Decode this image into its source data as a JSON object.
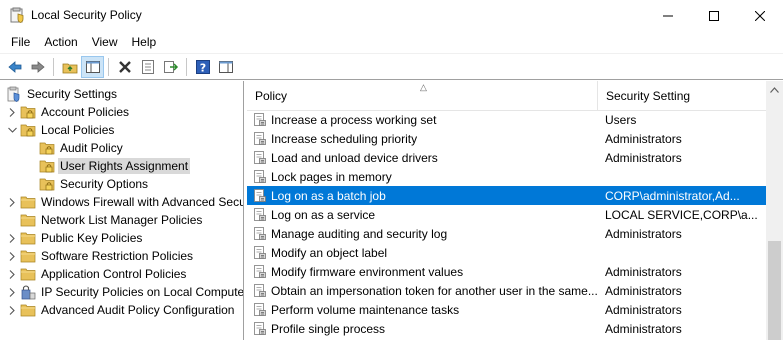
{
  "window": {
    "title": "Local Security Policy",
    "icon": "security-policy-icon"
  },
  "menu": {
    "items": [
      "File",
      "Action",
      "View",
      "Help"
    ]
  },
  "toolbar": {
    "buttons": [
      "back-arrow-icon",
      "forward-arrow-icon",
      "up-folder-icon",
      "show-hide-tree-icon",
      "delete-icon",
      "properties-icon",
      "export-list-icon",
      "help-icon",
      "action-pane-icon"
    ]
  },
  "tree": {
    "items": [
      {
        "label": "Security Settings",
        "level": 0,
        "expand": "",
        "icon": "security-settings-icon"
      },
      {
        "label": "Account Policies",
        "level": 1,
        "expand": "collapsed",
        "icon": "folder-lock-icon"
      },
      {
        "label": "Local Policies",
        "level": 1,
        "expand": "expanded",
        "icon": "folder-lock-icon"
      },
      {
        "label": "Audit Policy",
        "level": 2,
        "expand": "",
        "icon": "folder-lock-icon"
      },
      {
        "label": "User Rights Assignment",
        "level": 2,
        "expand": "",
        "icon": "folder-lock-icon",
        "selected": true
      },
      {
        "label": "Security Options",
        "level": 2,
        "expand": "",
        "icon": "folder-lock-icon"
      },
      {
        "label": "Windows Firewall with Advanced Secu",
        "level": 1,
        "expand": "collapsed",
        "icon": "folder-icon"
      },
      {
        "label": "Network List Manager Policies",
        "level": 1,
        "expand": "",
        "icon": "folder-icon"
      },
      {
        "label": "Public Key Policies",
        "level": 1,
        "expand": "collapsed",
        "icon": "folder-icon"
      },
      {
        "label": "Software Restriction Policies",
        "level": 1,
        "expand": "collapsed",
        "icon": "folder-icon"
      },
      {
        "label": "Application Control Policies",
        "level": 1,
        "expand": "collapsed",
        "icon": "folder-icon"
      },
      {
        "label": "IP Security Policies on Local Compute",
        "level": 1,
        "expand": "collapsed",
        "icon": "ip-security-icon"
      },
      {
        "label": "Advanced Audit Policy Configuration",
        "level": 1,
        "expand": "collapsed",
        "icon": "folder-icon"
      }
    ]
  },
  "list": {
    "headers": {
      "policy": "Policy",
      "setting": "Security Setting"
    },
    "rows": [
      {
        "policy": "Increase a process working set",
        "setting": "Users"
      },
      {
        "policy": "Increase scheduling priority",
        "setting": "Administrators"
      },
      {
        "policy": "Load and unload device drivers",
        "setting": "Administrators"
      },
      {
        "policy": "Lock pages in memory",
        "setting": ""
      },
      {
        "policy": "Log on as a batch job",
        "setting": "CORP\\administrator,Ad...",
        "selected": true
      },
      {
        "policy": "Log on as a service",
        "setting": "LOCAL SERVICE,CORP\\a..."
      },
      {
        "policy": "Manage auditing and security log",
        "setting": "Administrators"
      },
      {
        "policy": "Modify an object label",
        "setting": ""
      },
      {
        "policy": "Modify firmware environment values",
        "setting": "Administrators"
      },
      {
        "policy": "Obtain an impersonation token for another user in the same...",
        "setting": "Administrators"
      },
      {
        "policy": "Perform volume maintenance tasks",
        "setting": "Administrators"
      },
      {
        "policy": "Profile single process",
        "setting": "Administrators"
      }
    ]
  },
  "colors": {
    "selection": "#0078d7",
    "tree_selection": "#d9d9d9"
  }
}
